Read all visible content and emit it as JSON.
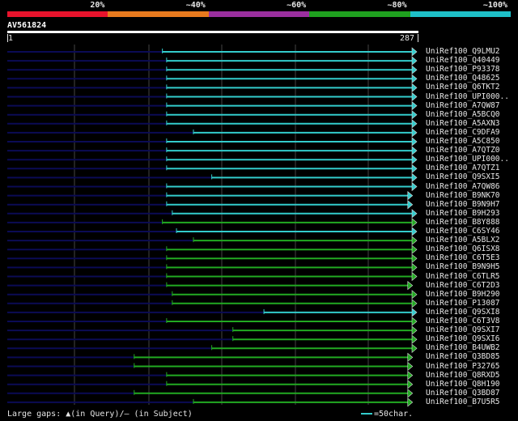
{
  "scale": {
    "segments": [
      {
        "label": "20%",
        "color": "#e8132c"
      },
      {
        "label": "~40%",
        "color": "#e87a1e"
      },
      {
        "label": "~60%",
        "color": "#9a2f9e"
      },
      {
        "label": "~80%",
        "color": "#1fa01f"
      },
      {
        "label": "~100%",
        "color": "#1ec0c8"
      }
    ]
  },
  "query": {
    "id": "AV561824",
    "start_label": "1",
    "end_label": "287",
    "length": 287
  },
  "colors": {
    "cyan": "#33cccc",
    "green": "#22aa22",
    "navy": "#0b0b55",
    "grid": "#444444",
    "arrow": "#ffffff"
  },
  "hits": [
    {
      "name": "UniRef100_Q9LMU2",
      "start": 110,
      "end": 287,
      "color": "cyan"
    },
    {
      "name": "UniRef100_Q40449",
      "start": 113,
      "end": 287,
      "color": "cyan"
    },
    {
      "name": "UniRef100_P93378",
      "start": 113,
      "end": 287,
      "color": "cyan"
    },
    {
      "name": "UniRef100_Q48625",
      "start": 113,
      "end": 287,
      "color": "cyan"
    },
    {
      "name": "UniRef100_Q6TKT2",
      "start": 113,
      "end": 287,
      "color": "cyan"
    },
    {
      "name": "UniRef100_UPI000..",
      "start": 113,
      "end": 287,
      "color": "cyan"
    },
    {
      "name": "UniRef100_A7QW87",
      "start": 113,
      "end": 287,
      "color": "cyan"
    },
    {
      "name": "UniRef100_A5BCQ0",
      "start": 113,
      "end": 287,
      "color": "cyan"
    },
    {
      "name": "UniRef100_A5AXN3",
      "start": 113,
      "end": 287,
      "color": "cyan"
    },
    {
      "name": "UniRef100_C9DFA9",
      "start": 132,
      "end": 287,
      "color": "cyan"
    },
    {
      "name": "UniRef100_A5C850",
      "start": 113,
      "end": 287,
      "color": "cyan"
    },
    {
      "name": "UniRef100_A7QTZ0",
      "start": 113,
      "end": 287,
      "color": "cyan"
    },
    {
      "name": "UniRef100_UPI000..",
      "start": 113,
      "end": 287,
      "color": "cyan"
    },
    {
      "name": "UniRef100_A7QTZ1",
      "start": 113,
      "end": 287,
      "color": "cyan"
    },
    {
      "name": "UniRef100_Q9SXI5",
      "start": 145,
      "end": 287,
      "color": "cyan"
    },
    {
      "name": "UniRef100_A7QW86",
      "start": 113,
      "end": 287,
      "color": "cyan"
    },
    {
      "name": "UniRef100_B9NK70",
      "start": 113,
      "end": 284,
      "color": "cyan"
    },
    {
      "name": "UniRef100_B9N9H7",
      "start": 113,
      "end": 284,
      "color": "cyan"
    },
    {
      "name": "UniRef100_B9H293",
      "start": 117,
      "end": 287,
      "color": "cyan"
    },
    {
      "name": "UniRef100_B8Y888",
      "start": 110,
      "end": 287,
      "color": "green"
    },
    {
      "name": "UniRef100_C6SY46",
      "start": 120,
      "end": 287,
      "color": "cyan"
    },
    {
      "name": "UniRef100_A5BLX2",
      "start": 132,
      "end": 287,
      "color": "green"
    },
    {
      "name": "UniRef100_Q6ISX8",
      "start": 113,
      "end": 287,
      "color": "green"
    },
    {
      "name": "UniRef100_C6T5E3",
      "start": 113,
      "end": 287,
      "color": "green"
    },
    {
      "name": "UniRef100_B9N9H5",
      "start": 113,
      "end": 287,
      "color": "green"
    },
    {
      "name": "UniRef100_C6TLR5",
      "start": 113,
      "end": 287,
      "color": "green"
    },
    {
      "name": "UniRef100_C6T2D3",
      "start": 113,
      "end": 284,
      "color": "green"
    },
    {
      "name": "UniRef100_B9H290",
      "start": 117,
      "end": 287,
      "color": "green"
    },
    {
      "name": "UniRef100_P13087",
      "start": 117,
      "end": 287,
      "color": "green"
    },
    {
      "name": "UniRef100_Q9SXI8",
      "start": 182,
      "end": 287,
      "color": "cyan"
    },
    {
      "name": "UniRef100_C6T3V8",
      "start": 113,
      "end": 287,
      "color": "green"
    },
    {
      "name": "UniRef100_Q9SXI7",
      "start": 160,
      "end": 287,
      "color": "green"
    },
    {
      "name": "UniRef100_Q9SXI6",
      "start": 160,
      "end": 287,
      "color": "green"
    },
    {
      "name": "UniRef100_B4UWB2",
      "start": 145,
      "end": 287,
      "color": "green"
    },
    {
      "name": "UniRef100_Q3BD85",
      "start": 90,
      "end": 284,
      "color": "green"
    },
    {
      "name": "UniRef100_P32765",
      "start": 90,
      "end": 284,
      "color": "green"
    },
    {
      "name": "UniRef100_Q8RXD5",
      "start": 113,
      "end": 284,
      "color": "green"
    },
    {
      "name": "UniRef100_Q8H190",
      "start": 113,
      "end": 284,
      "color": "green"
    },
    {
      "name": "UniRef100_Q3BD87",
      "start": 90,
      "end": 284,
      "color": "green"
    },
    {
      "name": "UniRef100_B7U5R5",
      "start": 132,
      "end": 284,
      "color": "green"
    }
  ],
  "legend": {
    "gaps_text": "Large gaps: ▲(in Query)/– (in Subject)",
    "scale_text": "=50char."
  }
}
